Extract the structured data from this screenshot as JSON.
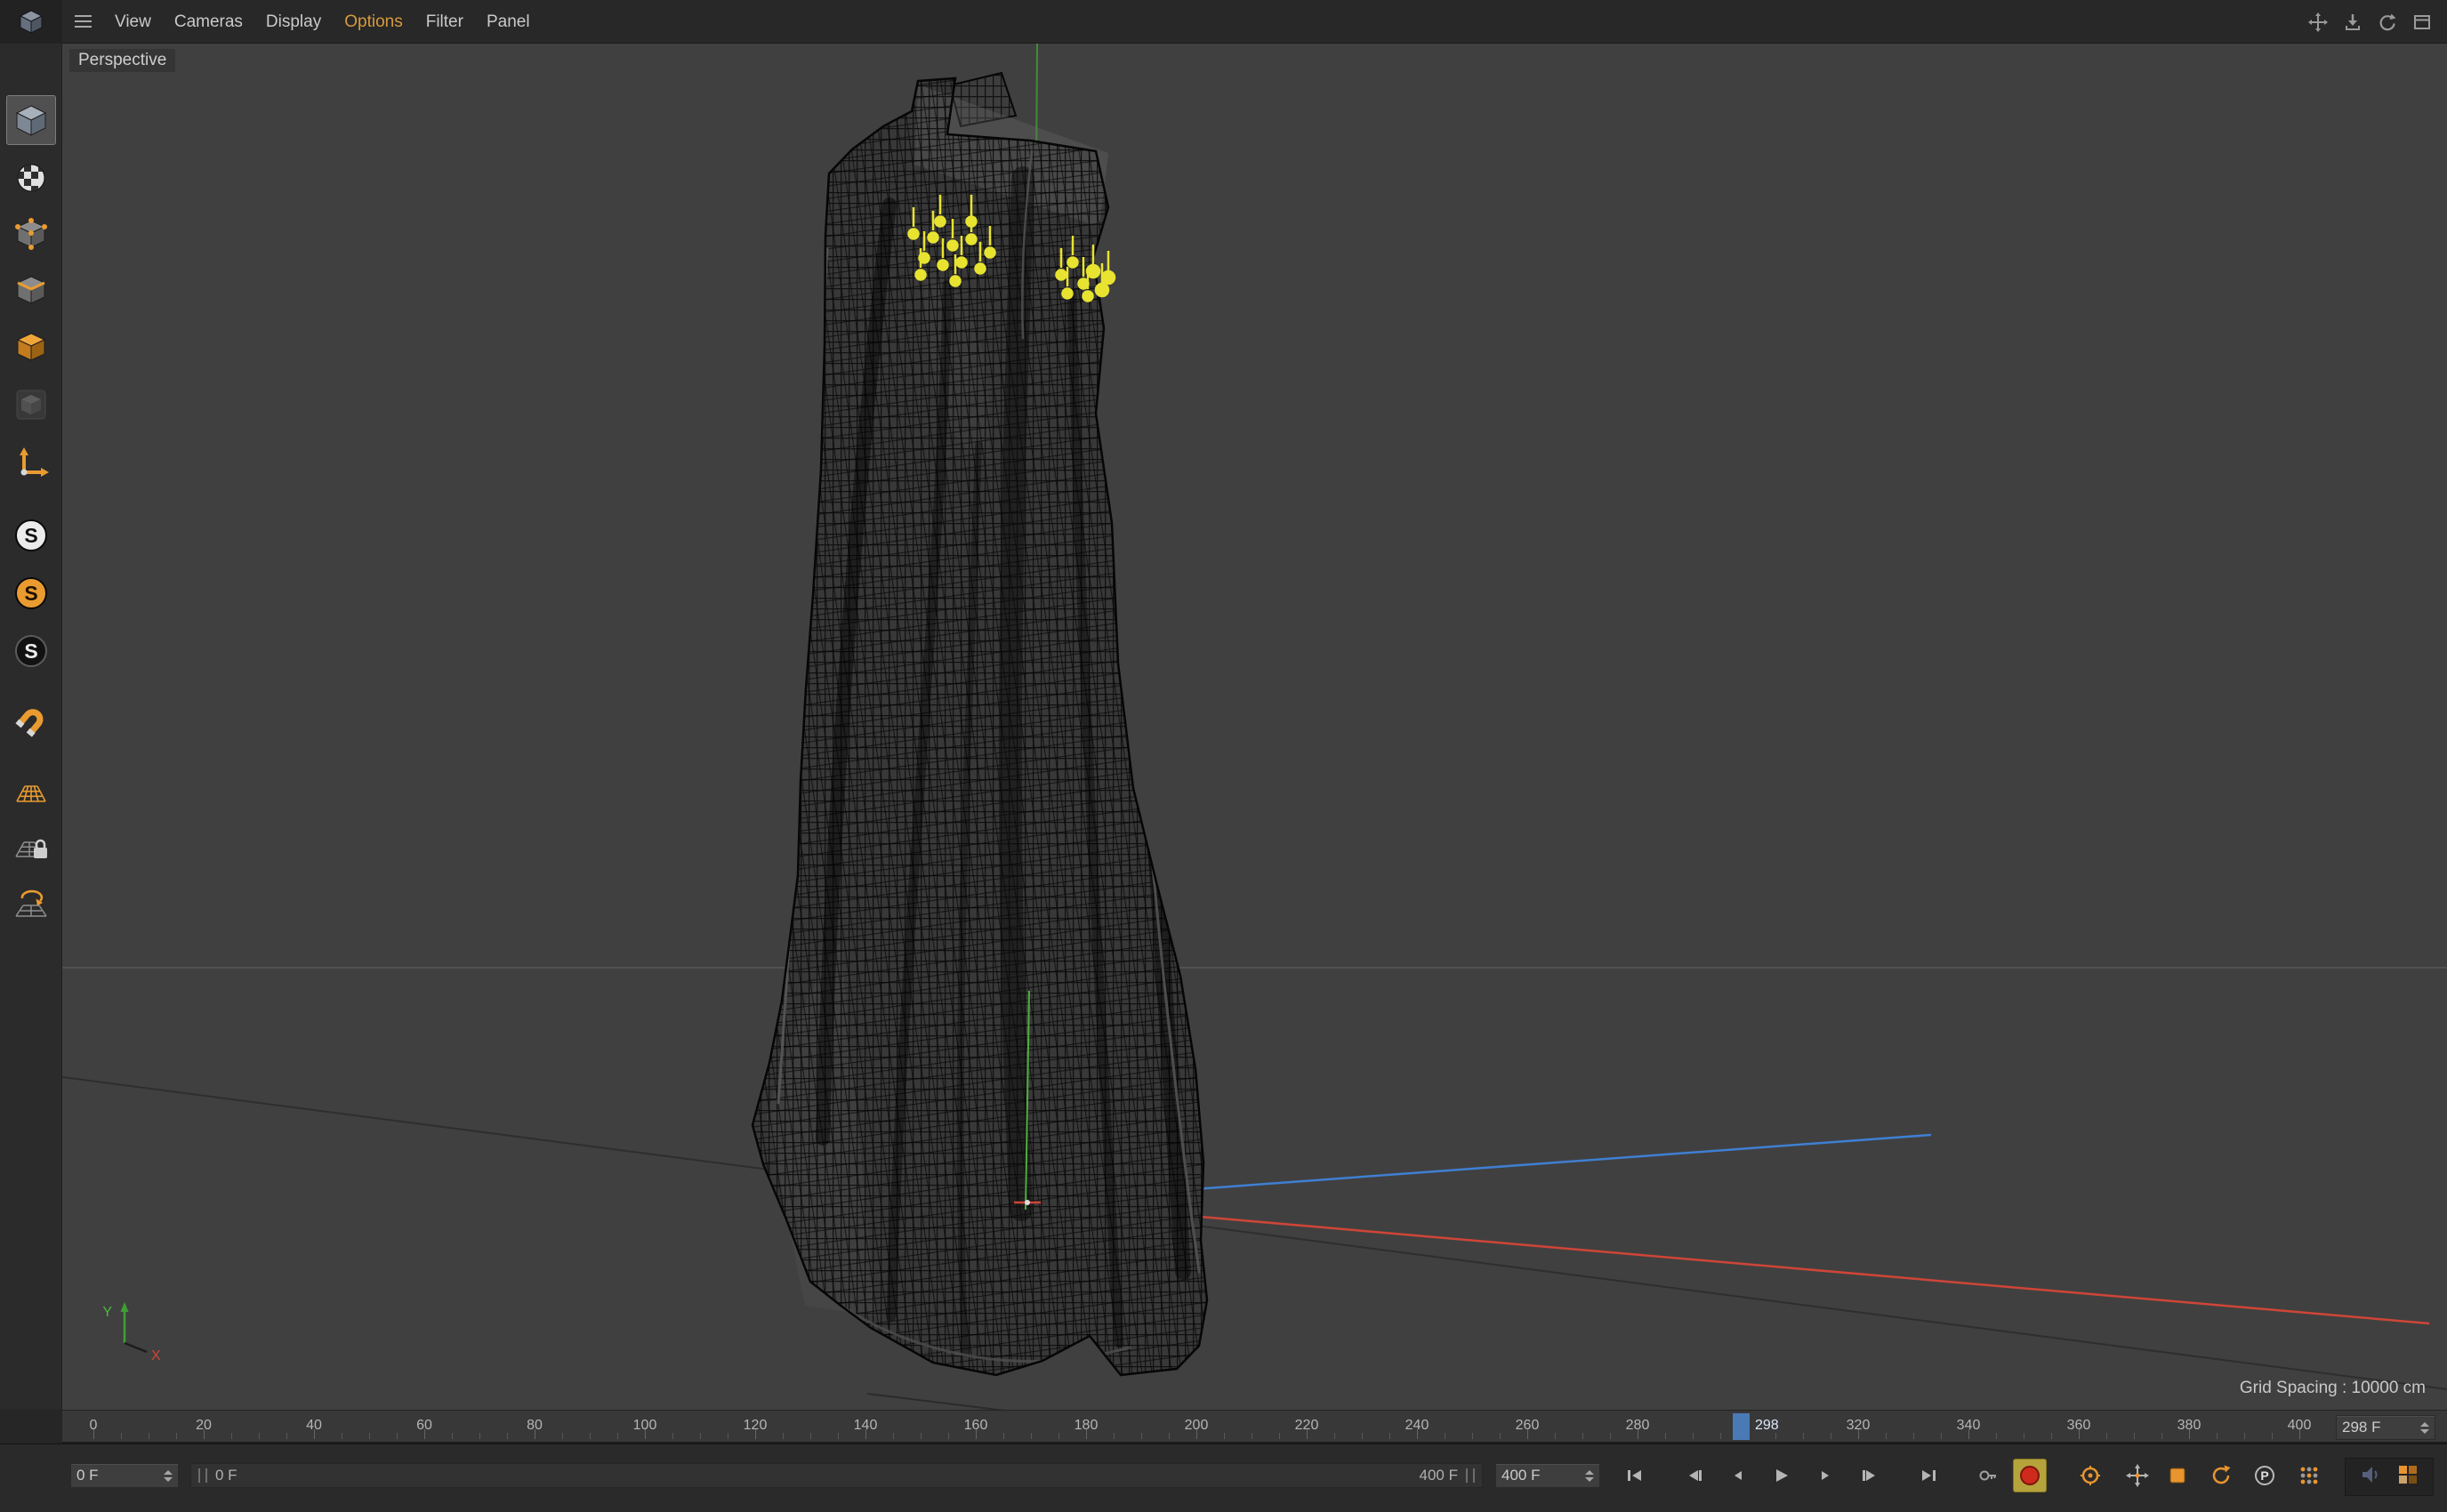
{
  "menubar": {
    "items": [
      {
        "label": "View"
      },
      {
        "label": "Cameras"
      },
      {
        "label": "Display"
      },
      {
        "label": "Options"
      },
      {
        "label": "Filter"
      },
      {
        "label": "Panel"
      }
    ],
    "active_item": "Options",
    "active_color": "#d79a3c"
  },
  "toolbar": {
    "items": [
      {
        "name": "model-mode",
        "glyph": ""
      },
      {
        "name": "texture-mode",
        "glyph": ""
      },
      {
        "name": "point-mode",
        "glyph": ""
      },
      {
        "name": "edge-mode",
        "glyph": ""
      },
      {
        "name": "polygon-mode",
        "glyph": ""
      },
      {
        "name": "tweak-mode",
        "glyph": ""
      },
      {
        "name": "enable-axis",
        "glyph": ""
      },
      {
        "name": "solo-off",
        "glyph": "S"
      },
      {
        "name": "solo-single",
        "glyph": "S"
      },
      {
        "name": "solo-hierarchy",
        "glyph": "S"
      },
      {
        "name": "enable-snap",
        "glyph": ""
      },
      {
        "name": "workplane",
        "glyph": ""
      },
      {
        "name": "lock-workplane",
        "glyph": ""
      },
      {
        "name": "align-workplane",
        "glyph": ""
      }
    ]
  },
  "viewport": {
    "label": "Perspective",
    "grid_spacing": "Grid Spacing : 10000 cm",
    "axis_gizmo": {
      "y": "Y",
      "x": "X"
    },
    "colors": {
      "background": "#404040",
      "axis_x": "#cf4537",
      "axis_y": "#4aa33c",
      "axis_z": "#3f7fd2",
      "selected_joints": "#e8e330",
      "mesh_wireframe": "#0a0a0a"
    }
  },
  "ruler": {
    "ticks": [
      "0",
      "20",
      "40",
      "60",
      "80",
      "100",
      "120",
      "140",
      "160",
      "180",
      "200",
      "220",
      "240",
      "260",
      "280",
      "320",
      "340",
      "360",
      "380",
      "400"
    ],
    "current_frame": "298",
    "frame_field_value": "298 F",
    "marker_color": "#4a7ab5"
  },
  "transport": {
    "start_frame_field": "0 F",
    "range_start_label": "0 F",
    "range_end_label": "400 F",
    "range_end_field": "400 F",
    "parameter_glyph": "P"
  }
}
